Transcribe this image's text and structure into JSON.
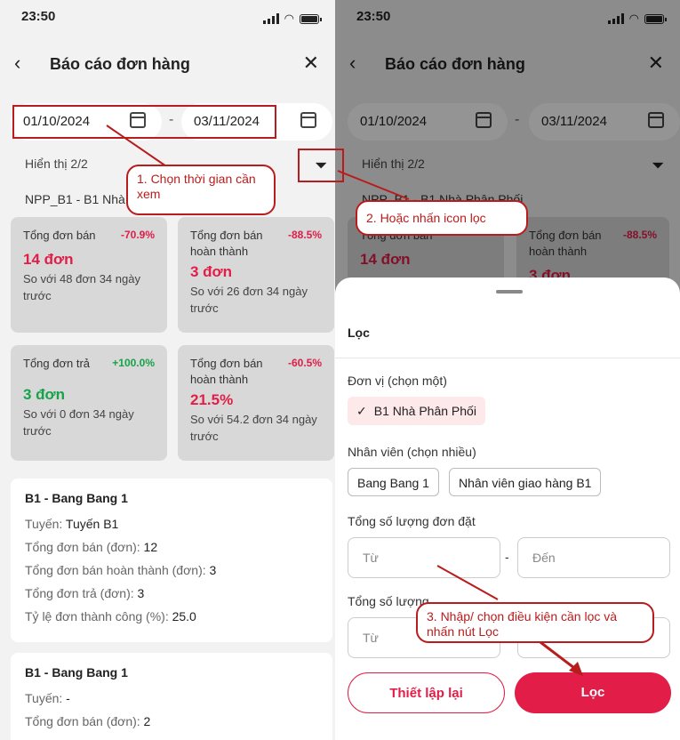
{
  "status": {
    "time": "23:50"
  },
  "header": {
    "back": "‹",
    "title": "Báo cáo đơn hàng",
    "close": "✕"
  },
  "date_range": {
    "from": "01/10/2024",
    "separator": "-",
    "to": "03/11/2024"
  },
  "display_count": "Hiển thị 2/2",
  "npp_label": "NPP_B1 - B1 Nhà",
  "npp_label_right": "NPP_B1 - B1 Nhà Phân Phối",
  "summary_cards": [
    {
      "label": "Tổng đơn bán",
      "pct": "-70.9%",
      "value": "14 đơn",
      "compare": "So với 48 đơn 34 ngày trước"
    },
    {
      "label": "Tổng đơn bán hoàn thành",
      "pct": "-88.5%",
      "value": "3 đơn",
      "compare": "So với 26 đơn 34 ngày trước"
    },
    {
      "label": "Tổng đơn trả",
      "pct": "+100.0%",
      "value": "3 đơn",
      "compare": "So với 0 đơn 34 ngày trước"
    },
    {
      "label": "Tổng đơn bán hoàn thành",
      "pct": "-60.5%",
      "value": "21.5%",
      "compare": "So với 54.2 đơn 34 ngày trước"
    }
  ],
  "details": [
    {
      "name": "B1 - Bang Bang 1",
      "rows": [
        {
          "label": "Tuyến: ",
          "value": "Tuyến B1"
        },
        {
          "label": "Tổng đơn bán (đơn): ",
          "value": "12"
        },
        {
          "label": "Tổng đơn bán hoàn thành (đơn): ",
          "value": "3"
        },
        {
          "label": "Tổng đơn trả (đơn): ",
          "value": "3"
        },
        {
          "label": "Tỷ lệ đơn thành công (%): ",
          "value": "25.0"
        }
      ]
    },
    {
      "name": "B1 - Bang Bang 1",
      "rows": [
        {
          "label": "Tuyến: ",
          "value": "-"
        },
        {
          "label": "Tổng đơn bán (đơn): ",
          "value": "2"
        }
      ]
    }
  ],
  "filter_sheet": {
    "title": "Lọc",
    "unit_label": "Đơn vị (chọn một)",
    "unit_selected": "B1 Nhà Phân Phối",
    "staff_label": "Nhân viên (chọn nhiều)",
    "staff_options": [
      "Bang Bang 1",
      "Nhân viên giao hàng B1"
    ],
    "qty_ordered_label": "Tổng số lượng đơn đặt",
    "qty_completed_label": "Tổng số lượng",
    "from_placeholder": "Từ",
    "to_placeholder": "Đến",
    "range_sep": "-",
    "reset_label": "Thiết lập lại",
    "apply_label": "Lọc"
  },
  "annotations": {
    "step1": "1. Chọn thời gian cần xem",
    "step2": "2. Hoặc nhấn icon lọc",
    "step3": "3. Nhập/ chọn điều kiện cần lọc và nhấn nút Lọc"
  },
  "colors": {
    "accent": "#e11d48",
    "negative": "#e11d48",
    "positive": "#16a34a",
    "annotation": "#b91c1c"
  },
  "icons": {
    "back": "chevron-left-icon",
    "close": "close-icon",
    "calendar": "calendar-icon",
    "filter": "filter-icon",
    "check": "check-icon"
  }
}
